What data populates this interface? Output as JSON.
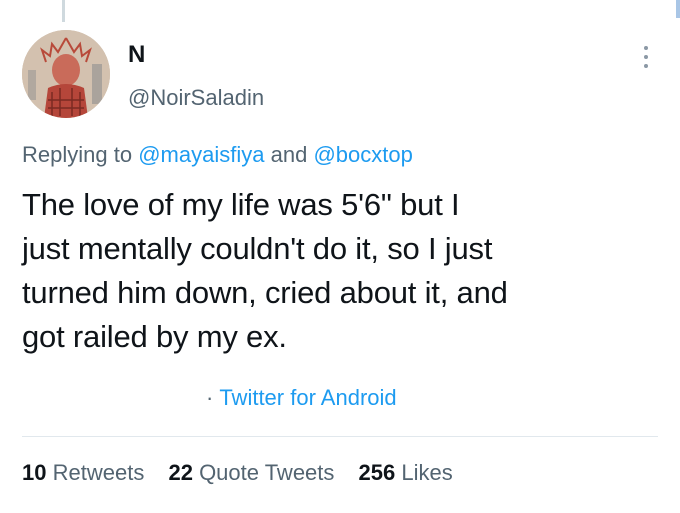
{
  "tweet": {
    "author": {
      "display_name": "N",
      "handle": "@NoirSaladin"
    },
    "replying": {
      "prefix": "Replying to",
      "mention_1": "@mayaisfiya",
      "joiner": "and",
      "mention_2": "@bocxtop"
    },
    "text_lines": [
      "The love of my life was 5'6\" but I",
      "just mentally couldn't do it, so I just",
      "turned him down, cried about it, and",
      "got railed by my ex."
    ],
    "source": {
      "separator": "·",
      "label": "Twitter for Android"
    },
    "stats": {
      "retweets_count": "10",
      "retweets_label": "Retweets",
      "quotes_count": "22",
      "quotes_label": "Quote Tweets",
      "likes_count": "256",
      "likes_label": "Likes"
    }
  },
  "icons": {
    "more": "more-options-icon",
    "avatar": "profile-avatar"
  },
  "colors": {
    "link": "#1d9bf0",
    "secondary_text": "#536471",
    "primary_text": "#0f1419",
    "divider": "#e1e8ed"
  }
}
